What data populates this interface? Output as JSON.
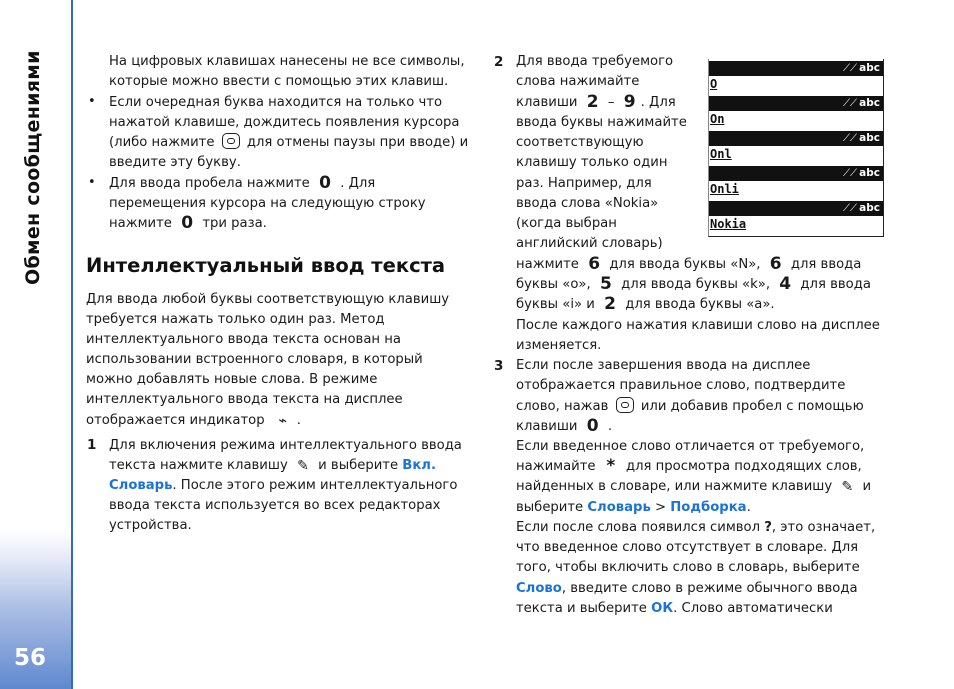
{
  "sidebar": {
    "section_title": "Обмен сообщениями",
    "page_number": "56"
  },
  "left": {
    "intro": [
      "На цифровых клавишах нанесены не все символы,",
      "которые можно ввести с помощью этих клавиш."
    ],
    "bullet1": [
      "Если очередная буква находится на только что",
      "нажатой клавише, дождитесь появления курсора",
      "(либо нажмите",
      "для отмены паузы при вводе) и",
      "введите эту букву."
    ],
    "bullet2": [
      "Для ввода пробела нажмите",
      ". Для",
      "перемещения курсора на следующую строку",
      "нажмите",
      "три раза."
    ],
    "heading": "Интеллектуальный ввод текста",
    "para": [
      "Для ввода любой буквы соответствующую клавишу",
      "требуется нажать только один раз. Метод",
      "интеллектуального ввода текста основан на",
      "использовании встроенного словаря, в который",
      "можно добавлять новые слова. В режиме",
      "интеллектуального ввода текста на дисплее",
      "отображается индикатор",
      "."
    ],
    "step1": {
      "num": "1",
      "lines": [
        "Для включения режима интеллектуального ввода",
        "текста нажмите клавишу",
        "и выберите",
        "Вкл.",
        "Словарь",
        ". После этого режим интеллектуального",
        "ввода текста используется во всех редакторах",
        "устройства."
      ]
    }
  },
  "right": {
    "step2": {
      "num": "2",
      "lines": [
        "Для ввода требуемого",
        "слова нажимайте",
        "клавиши",
        "–",
        ". Для",
        "ввода буквы нажимайте",
        "соответствующую",
        "клавишу только один",
        "раз. Например, для",
        "ввода слова «Nokia»",
        "(когда выбран",
        "английский словарь)"
      ],
      "cont": [
        "нажмите",
        "для ввода буквы «N»,",
        "для ввода",
        "буквы «o»,",
        "для ввода буквы «k»,",
        "для ввода",
        "буквы «i» и",
        "для ввода буквы «a».",
        "После каждого нажатия клавиши слово на дисплее",
        "изменяется."
      ]
    },
    "step3": {
      "num": "3",
      "lines": [
        "Если после завершения ввода на дисплее",
        "отображается правильное слово, подтвердите",
        "слово, нажав",
        "или добавив пробел с помощью",
        "клавиши",
        ".",
        "Если введенное слово отличается от требуемого,",
        "нажимайте",
        "для просмотра подходящих слов,",
        "найденных в словаре, или нажмите клавишу",
        "и",
        "выберите",
        "Словарь",
        ">",
        "Подборка",
        ".",
        "Если после слова появился символ",
        "?",
        ", это означает,",
        "что введенное слово отсутствует в словаре. Для",
        "того, чтобы включить слово в словарь, выберите",
        "Слово",
        ", введите слово в режиме обычного ввода",
        "текста и выберите",
        "ОК",
        ". Слово автоматически"
      ]
    },
    "keys": {
      "k0": "0",
      "k2": "2",
      "k9": "9",
      "k6": "6",
      "k5": "5",
      "k4": "4",
      "star": "*",
      "pencil": "✎",
      "predictive": "⌁"
    }
  },
  "screens": {
    "mode_label": "abc",
    "words": [
      "O",
      "On",
      "Onl",
      "Onli",
      "Nokia"
    ]
  }
}
